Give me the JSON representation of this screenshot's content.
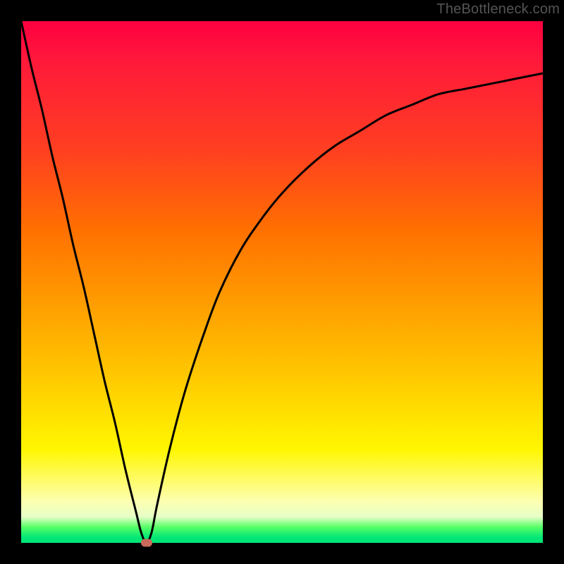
{
  "attribution": "TheBottleneck.com",
  "colors": {
    "frame_border": "#000000",
    "curve_stroke": "#000000",
    "marker_fill": "#c96a5a",
    "gradient_top": "#ff0040",
    "gradient_bottom": "#00e676"
  },
  "chart_data": {
    "type": "line",
    "title": "",
    "xlabel": "",
    "ylabel": "",
    "xlim": [
      0,
      100
    ],
    "ylim": [
      0,
      100
    ],
    "x": [
      0,
      2,
      4,
      6,
      8,
      10,
      12,
      14,
      16,
      18,
      20,
      22,
      23,
      24,
      25,
      26,
      28,
      30,
      32,
      35,
      38,
      42,
      46,
      50,
      55,
      60,
      65,
      70,
      75,
      80,
      85,
      90,
      95,
      100
    ],
    "y": [
      100,
      91,
      83,
      74,
      66,
      57,
      49,
      40,
      31,
      23,
      14,
      6,
      2,
      0,
      2,
      7,
      16,
      24,
      31,
      40,
      48,
      56,
      62,
      67,
      72,
      76,
      79,
      82,
      84,
      86,
      87,
      88,
      89,
      90
    ],
    "minimum_point": {
      "x": 24,
      "y": 0
    },
    "series": [
      {
        "name": "bottleneck-curve",
        "stroke": "#000000"
      }
    ],
    "grid": false,
    "legend": false
  }
}
